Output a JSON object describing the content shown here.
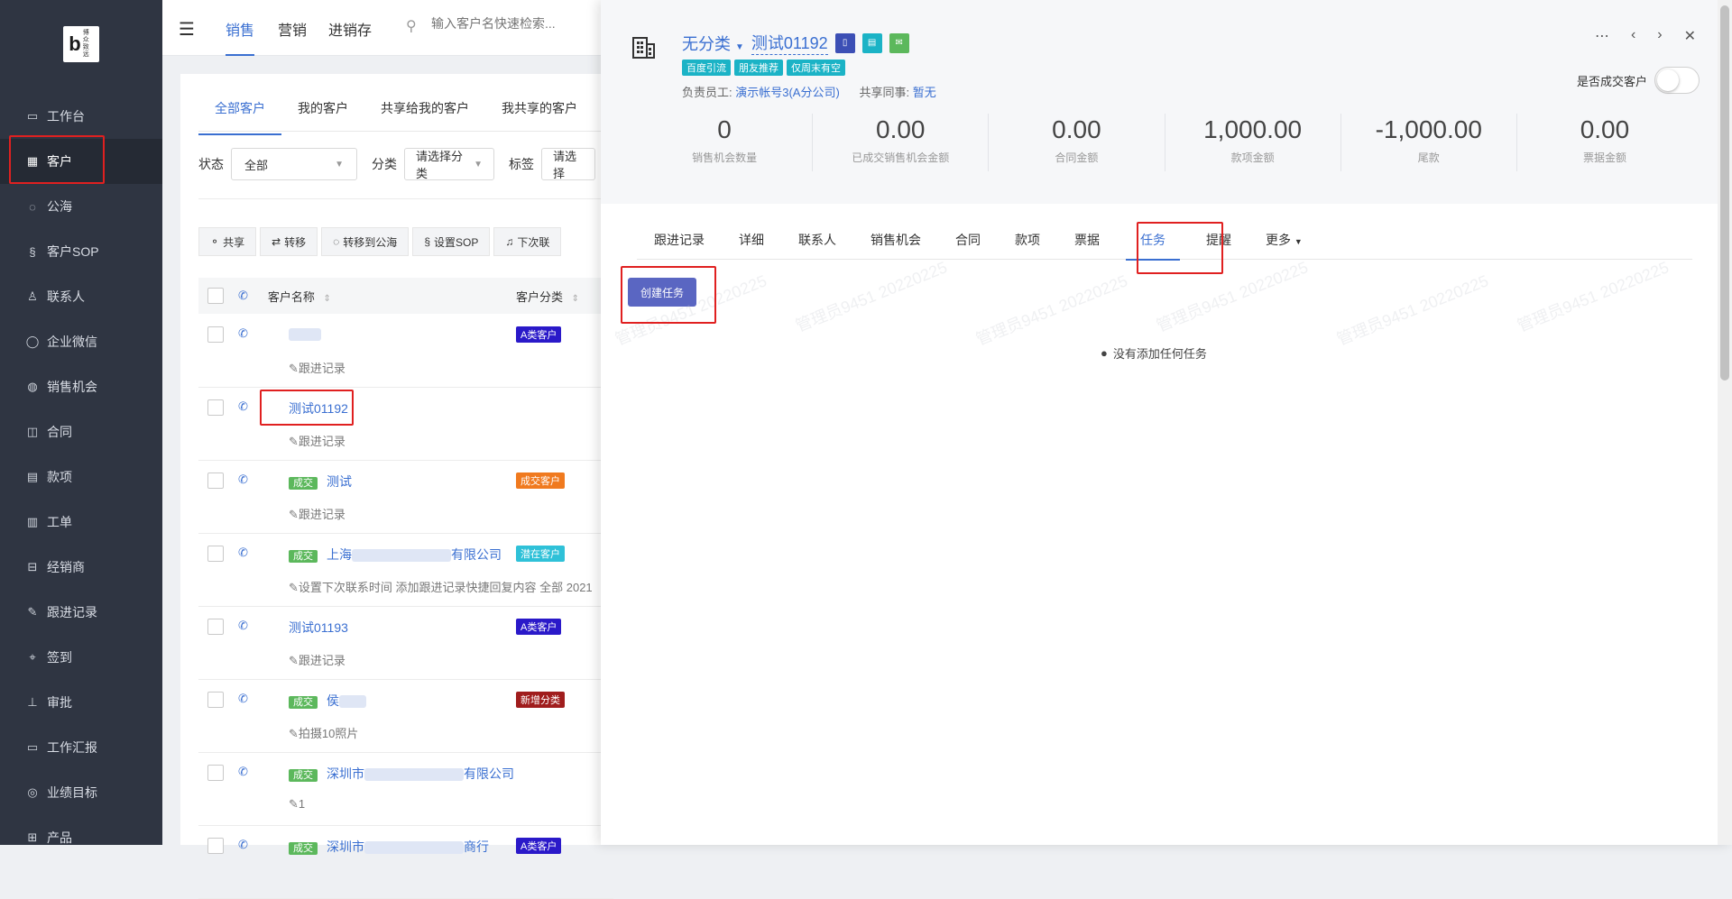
{
  "sidebar": {
    "logo_text": "博众致远",
    "items": [
      {
        "label": "工作台",
        "icon": "monitor-icon"
      },
      {
        "label": "客户",
        "icon": "building-icon",
        "active": true
      },
      {
        "label": "公海",
        "icon": "sea-icon"
      },
      {
        "label": "客户SOP",
        "icon": "sop-icon"
      },
      {
        "label": "联系人",
        "icon": "contact-icon"
      },
      {
        "label": "企业微信",
        "icon": "wechat-icon"
      },
      {
        "label": "销售机会",
        "icon": "moneybag-icon"
      },
      {
        "label": "合同",
        "icon": "contract-icon"
      },
      {
        "label": "款项",
        "icon": "payment-icon"
      },
      {
        "label": "工单",
        "icon": "ticket-icon"
      },
      {
        "label": "经销商",
        "icon": "dealer-icon"
      },
      {
        "label": "跟进记录",
        "icon": "edit-icon"
      },
      {
        "label": "签到",
        "icon": "location-icon"
      },
      {
        "label": "审批",
        "icon": "stamp-icon"
      },
      {
        "label": "工作汇报",
        "icon": "report-icon"
      },
      {
        "label": "业绩目标",
        "icon": "target-icon"
      },
      {
        "label": "产品",
        "icon": "grid-icon"
      }
    ]
  },
  "topbar": {
    "tabs": [
      "销售",
      "营销",
      "进销存"
    ],
    "search_placeholder": "输入客户名快速检索..."
  },
  "list": {
    "subtabs": [
      "全部客户",
      "我的客户",
      "共享给我的客户",
      "我共享的客户"
    ],
    "filters": {
      "status_label": "状态",
      "status_value": "全部",
      "category_label": "分类",
      "category_value": "请选择分类",
      "tag_label": "标签",
      "tag_value": "请选择"
    },
    "actions": [
      "共享",
      "转移",
      "转移到公海",
      "设置SOP",
      "下次联"
    ],
    "columns": {
      "name": "客户名称",
      "category": "客户分类"
    },
    "rows": [
      {
        "deal": "",
        "name": "",
        "category": "A类客户",
        "category_color": "#2a19c9",
        "follow": "跟进记录"
      },
      {
        "deal": "",
        "name": "测试01192",
        "category": "",
        "category_color": "",
        "follow": "跟进记录"
      },
      {
        "deal": "成交",
        "name": "测试",
        "category": "成交客户",
        "category_color": "#f07a1f",
        "follow": "跟进记录"
      },
      {
        "deal": "成交",
        "name": "上海",
        "name_suffix": "有限公司",
        "category": "潜在客户",
        "category_color": "#2fc1d8",
        "follow": "设置下次联系时间 添加跟进记录快捷回复内容 全部 2021"
      },
      {
        "deal": "",
        "name": "测试01193",
        "category": "A类客户",
        "category_color": "#2a19c9",
        "follow": "跟进记录"
      },
      {
        "deal": "成交",
        "name": "侯",
        "category": "新增分类",
        "category_color": "#a01d1d",
        "follow": "拍摄10照片"
      },
      {
        "deal": "成交",
        "name": "深圳市",
        "name_suffix": "有限公司",
        "category": "",
        "category_color": "",
        "follow": "1"
      },
      {
        "deal": "成交",
        "name": "深圳市",
        "name_suffix": "商行",
        "category": "A类客户",
        "category_color": "#2a19c9",
        "follow": ""
      }
    ]
  },
  "detail": {
    "category": "无分类",
    "customer_name": "测试01192",
    "tags": [
      "百度引流",
      "朋友推荐",
      "仅周末有空"
    ],
    "owner_label": "负责员工:",
    "owner_value": "演示帐号3(A分公司)",
    "share_label": "共享同事:",
    "share_value": "暂无",
    "deal_toggle_label": "是否成交客户",
    "deal_toggle_on": false,
    "stats": [
      {
        "value": "0",
        "label": "销售机会数量"
      },
      {
        "value": "0.00",
        "label": "已成交销售机会金额"
      },
      {
        "value": "0.00",
        "label": "合同金额"
      },
      {
        "value": "1,000.00",
        "label": "款项金额"
      },
      {
        "value": "-1,000.00",
        "label": "尾款"
      },
      {
        "value": "0.00",
        "label": "票据金额"
      }
    ],
    "tabs": [
      "跟进记录",
      "详细",
      "联系人",
      "销售机会",
      "合同",
      "款项",
      "票据",
      "任务",
      "提醒",
      "更多"
    ],
    "active_tab": "任务",
    "create_button": "创建任务",
    "empty_text": "没有添加任何任务",
    "watermark": "管理员9451 20220225"
  },
  "colors": {
    "accent": "#3a6fd1",
    "sidebar_bg": "#2f3542",
    "highlight": "#e02020",
    "button": "#5a66c2"
  }
}
